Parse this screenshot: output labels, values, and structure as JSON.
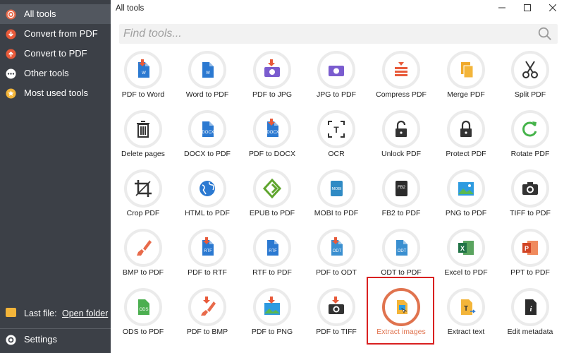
{
  "window": {
    "title": "All tools"
  },
  "search": {
    "placeholder": "Find tools..."
  },
  "sidebar": {
    "items": [
      {
        "label": "All tools",
        "icon": "target-icon",
        "color": "#e86a4a"
      },
      {
        "label": "Convert from PDF",
        "icon": "arrow-down-icon",
        "color": "#e85a3a"
      },
      {
        "label": "Convert to PDF",
        "icon": "arrow-up-icon",
        "color": "#e85a3a"
      },
      {
        "label": "Other tools",
        "icon": "more-icon",
        "color": "#ffffff"
      },
      {
        "label": "Most used tools",
        "icon": "star-icon",
        "color": "#f3b53a"
      }
    ],
    "last_file_label": "Last file:",
    "open_folder": "Open folder",
    "settings": "Settings"
  },
  "tools": [
    {
      "label": "PDF to Word",
      "icon": "pdf-to-word-icon"
    },
    {
      "label": "Word to PDF",
      "icon": "word-to-pdf-icon"
    },
    {
      "label": "PDF to JPG",
      "icon": "pdf-to-jpg-icon"
    },
    {
      "label": "JPG to PDF",
      "icon": "jpg-to-pdf-icon"
    },
    {
      "label": "Compress PDF",
      "icon": "compress-icon"
    },
    {
      "label": "Merge PDF",
      "icon": "merge-icon"
    },
    {
      "label": "Split PDF",
      "icon": "scissors-icon"
    },
    {
      "label": "Delete pages",
      "icon": "trash-icon"
    },
    {
      "label": "DOCX to PDF",
      "icon": "docx-to-pdf-icon"
    },
    {
      "label": "PDF to DOCX",
      "icon": "pdf-to-docx-icon"
    },
    {
      "label": "OCR",
      "icon": "ocr-icon"
    },
    {
      "label": "Unlock PDF",
      "icon": "unlock-icon"
    },
    {
      "label": "Protect PDF",
      "icon": "lock-icon"
    },
    {
      "label": "Rotate PDF",
      "icon": "rotate-icon"
    },
    {
      "label": "Crop PDF",
      "icon": "crop-icon"
    },
    {
      "label": "HTML to PDF",
      "icon": "globe-icon"
    },
    {
      "label": "EPUB to PDF",
      "icon": "epub-icon"
    },
    {
      "label": "MOBI to PDF",
      "icon": "mobi-icon"
    },
    {
      "label": "FB2 to PDF",
      "icon": "fb2-icon"
    },
    {
      "label": "PNG to PDF",
      "icon": "png-icon"
    },
    {
      "label": "TIFF to PDF",
      "icon": "camera-icon"
    },
    {
      "label": "BMP to PDF",
      "icon": "brush-icon"
    },
    {
      "label": "PDF to RTF",
      "icon": "pdf-to-rtf-icon"
    },
    {
      "label": "RTF to PDF",
      "icon": "rtf-to-pdf-icon"
    },
    {
      "label": "PDF to ODT",
      "icon": "pdf-to-odt-icon"
    },
    {
      "label": "ODT to PDF",
      "icon": "odt-to-pdf-icon"
    },
    {
      "label": "Excel to PDF",
      "icon": "excel-icon"
    },
    {
      "label": "PPT to PDF",
      "icon": "ppt-icon"
    },
    {
      "label": "ODS to PDF",
      "icon": "ods-icon"
    },
    {
      "label": "PDF to BMP",
      "icon": "pdf-to-bmp-icon"
    },
    {
      "label": "PDF to PNG",
      "icon": "pdf-to-png-icon"
    },
    {
      "label": "PDF to TIFF",
      "icon": "pdf-to-tiff-icon"
    },
    {
      "label": "Extract images",
      "icon": "extract-images-icon",
      "selected": true
    },
    {
      "label": "Extract text",
      "icon": "extract-text-icon"
    },
    {
      "label": "Edit metadata",
      "icon": "metadata-icon"
    }
  ],
  "colors": {
    "sidebar_bg": "#3c4047",
    "accent": "#e0734e",
    "highlight_box": "#d92020",
    "word_blue": "#2b79d1"
  }
}
